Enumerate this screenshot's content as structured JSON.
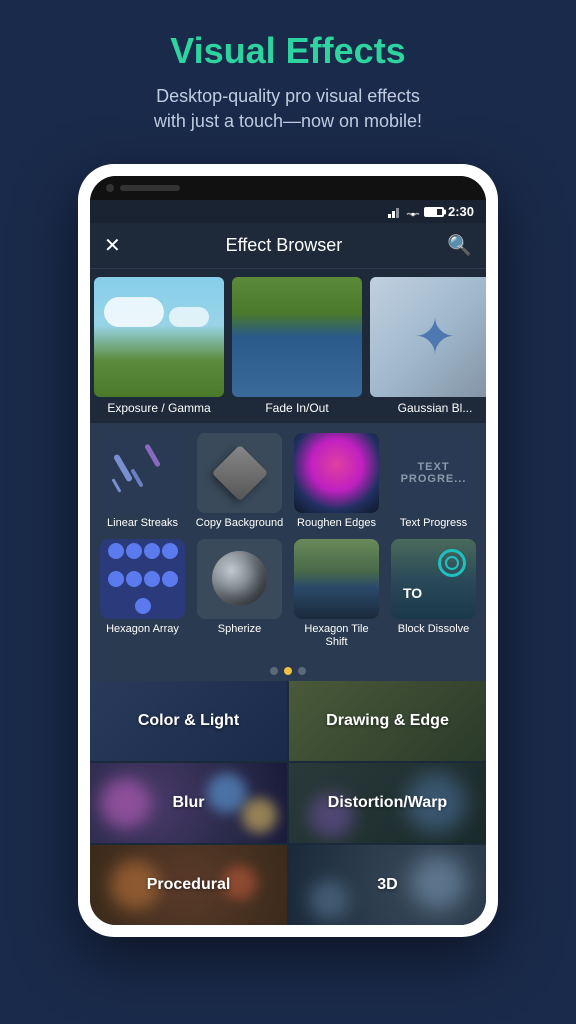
{
  "page": {
    "background_color": "#1a2a4a",
    "title": "Visual Effects",
    "subtitle": "Desktop-quality pro visual effects\nwith just a touch—now on mobile!"
  },
  "status_bar": {
    "time": "2:30"
  },
  "app_header": {
    "title": "Effect Browser",
    "close_label": "✕",
    "search_label": "🔍"
  },
  "featured_items": [
    {
      "label": "Exposure / Gamma",
      "type": "sky"
    },
    {
      "label": "Fade In/Out",
      "type": "lake"
    },
    {
      "label": "Gaussian Bl...",
      "type": "star"
    }
  ],
  "grid_effects": [
    {
      "label": "Linear Streaks",
      "type": "linear-streaks"
    },
    {
      "label": "Copy Background",
      "type": "copy-bg"
    },
    {
      "label": "Roughen Edges",
      "type": "roughen"
    },
    {
      "label": "Text Progress",
      "type": "text-progress"
    },
    {
      "label": "Hexagon Array",
      "type": "hex-array"
    },
    {
      "label": "Spherize",
      "type": "spherize"
    },
    {
      "label": "Hexagon Tile Shift",
      "type": "hex-tile"
    },
    {
      "label": "Block Dissolve",
      "type": "block-dissolve"
    }
  ],
  "pagination": {
    "dots": [
      {
        "active": false
      },
      {
        "active": true
      },
      {
        "active": false
      }
    ]
  },
  "categories": [
    {
      "label": "Color & Light",
      "color": "light"
    },
    {
      "label": "Drawing & Edge",
      "color": "drawing"
    },
    {
      "label": "Blur",
      "color": "blur"
    },
    {
      "label": "Distortion/Warp",
      "color": "distortion"
    },
    {
      "label": "Procedural",
      "color": "procedural"
    },
    {
      "label": "3D",
      "color": "3d"
    }
  ]
}
